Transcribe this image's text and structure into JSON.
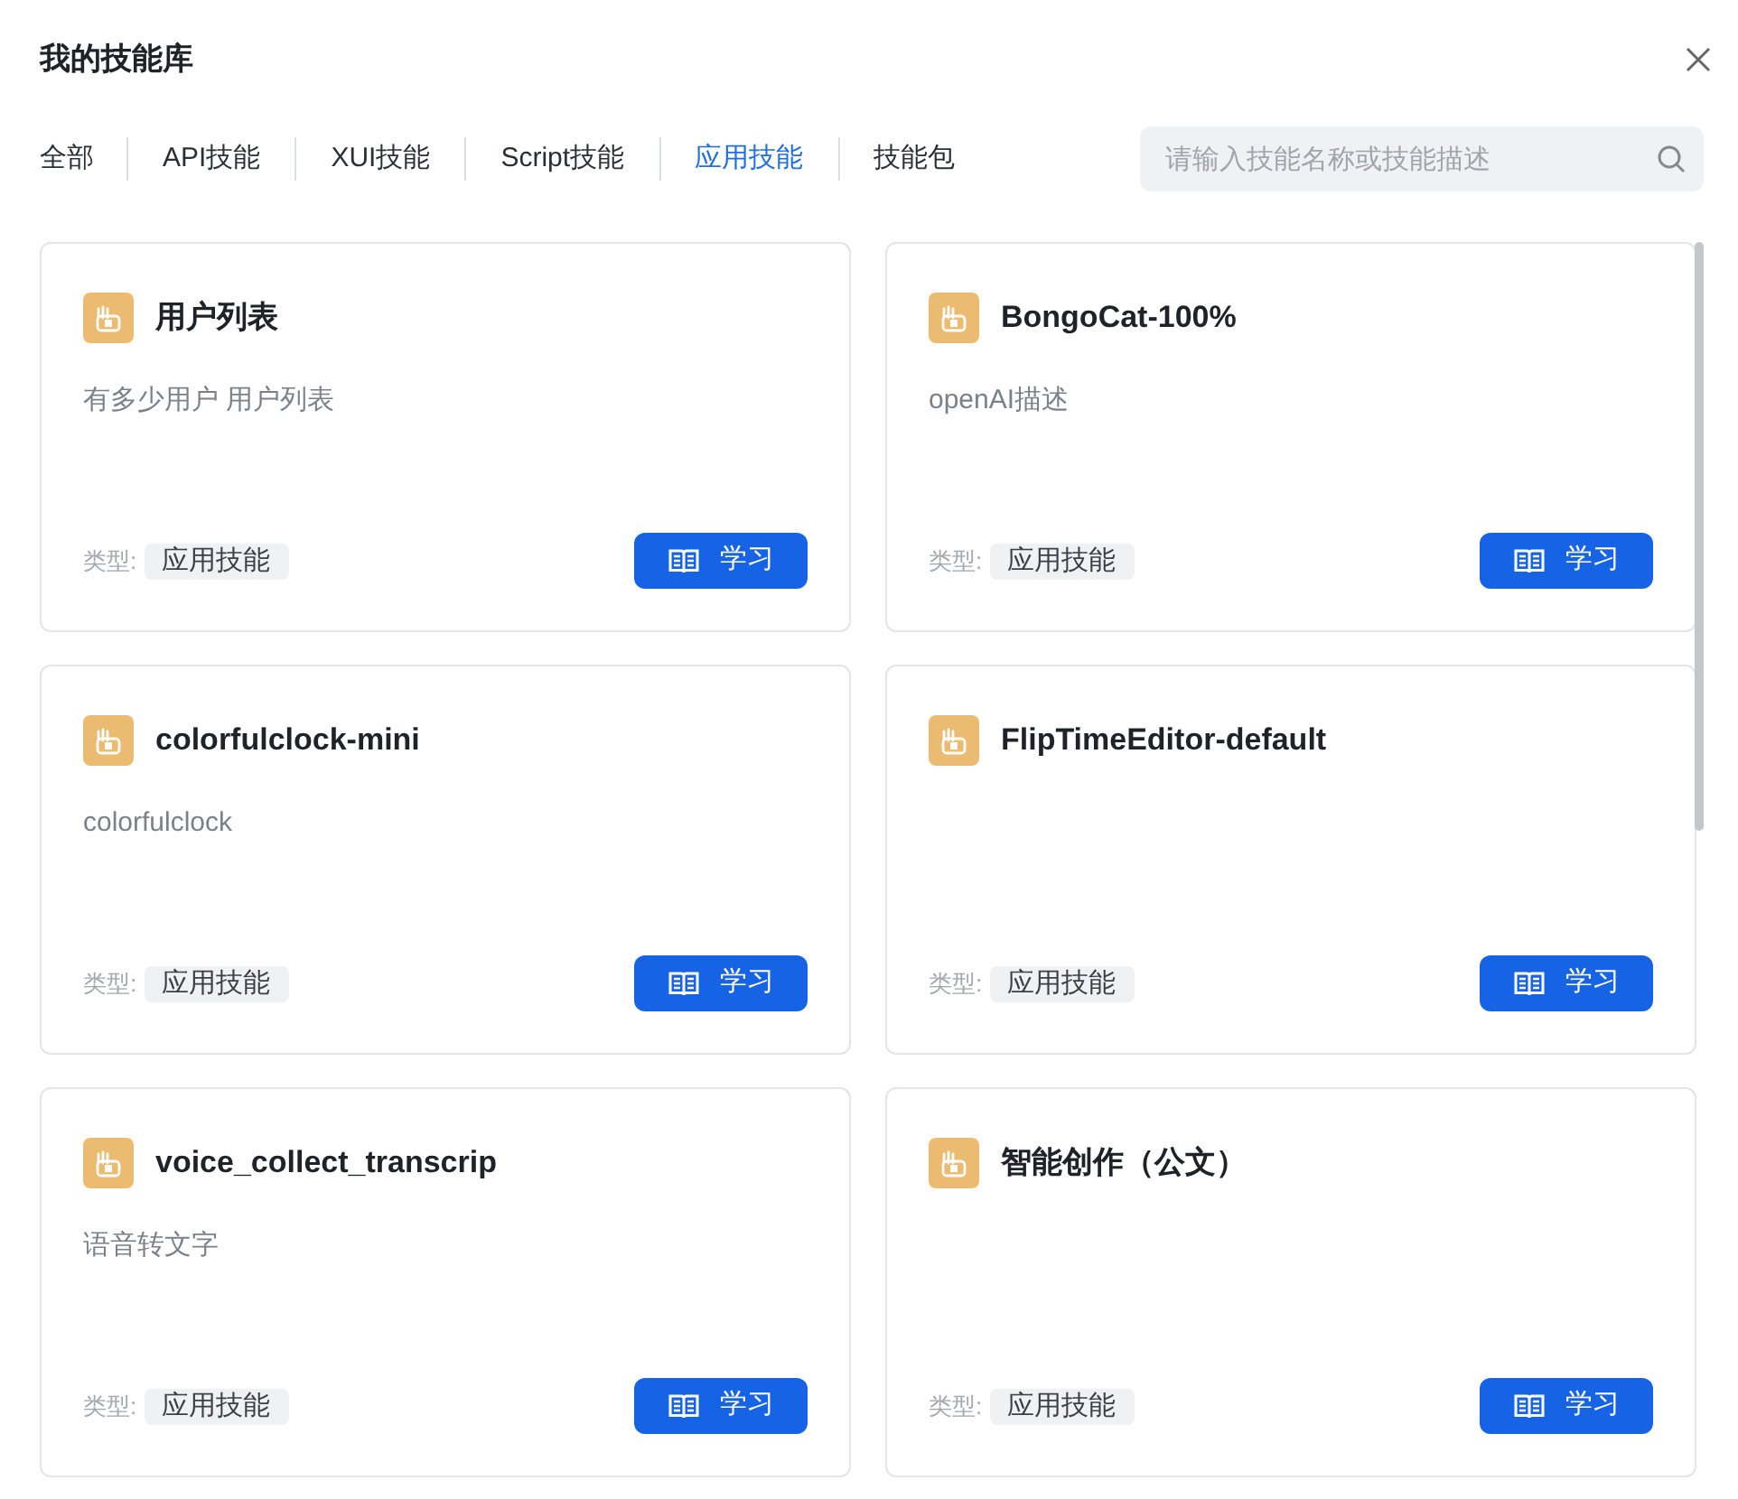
{
  "dialog": {
    "title": "我的技能库"
  },
  "tabs": [
    {
      "label": "全部",
      "selected": false
    },
    {
      "label": "API技能",
      "selected": false
    },
    {
      "label": "XUI技能",
      "selected": false
    },
    {
      "label": "Script技能",
      "selected": false
    },
    {
      "label": "应用技能",
      "selected": true
    },
    {
      "label": "技能包",
      "selected": false
    }
  ],
  "search": {
    "placeholder": "请输入技能名称或技能描述"
  },
  "skills": [
    {
      "name": "用户列表",
      "description": "有多少用户 用户列表",
      "type_label": "类型:",
      "type": "应用技能",
      "button": "学习"
    },
    {
      "name": "BongoCat-100%",
      "description": "openAI描述",
      "type_label": "类型:",
      "type": "应用技能",
      "button": "学习"
    },
    {
      "name": "colorfulclock-mini",
      "description": "colorfulclock",
      "type_label": "类型:",
      "type": "应用技能",
      "button": "学习"
    },
    {
      "name": "FlipTimeEditor-default",
      "type_label": "类型:",
      "type": "应用技能",
      "button": "学习"
    },
    {
      "name": "voice_collect_transcrip",
      "description": "语音转文字",
      "type_label": "类型:",
      "type": "应用技能",
      "button": "学习"
    },
    {
      "name": "智能创作（公文）",
      "type_label": "类型:",
      "type": "应用技能",
      "button": "学习"
    }
  ]
}
